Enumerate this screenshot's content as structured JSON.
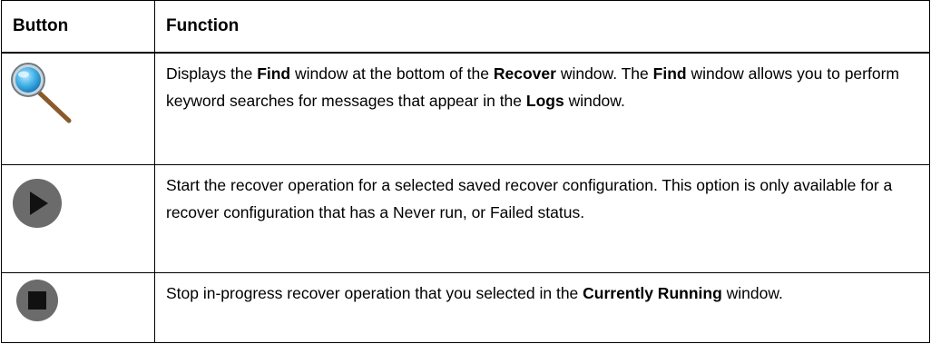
{
  "table": {
    "headers": {
      "button": "Button",
      "function": "Function"
    },
    "rows": [
      {
        "icon": "find-magnifier-icon",
        "segments": [
          {
            "text": "Displays the ",
            "bold": false
          },
          {
            "text": "Find",
            "bold": true
          },
          {
            "text": " window at the bottom of the ",
            "bold": false
          },
          {
            "text": "Recover",
            "bold": true
          },
          {
            "text": " window. The ",
            "bold": false
          },
          {
            "text": "Find",
            "bold": true
          },
          {
            "text": " window allows you to perform keyword searches for messages that appear in the ",
            "bold": false
          },
          {
            "text": "Logs",
            "bold": true
          },
          {
            "text": " window.",
            "bold": false
          }
        ]
      },
      {
        "icon": "play-icon",
        "segments": [
          {
            "text": "Start the recover operation for a selected saved recover configuration. This option is only available for a recover configuration that has a Never run, or Failed status.",
            "bold": false
          }
        ]
      },
      {
        "icon": "stop-icon",
        "segments": [
          {
            "text": "Stop in-progress recover operation that you selected in the ",
            "bold": false
          },
          {
            "text": "Currently Running",
            "bold": true
          },
          {
            "text": " window.",
            "bold": false
          }
        ]
      }
    ]
  }
}
